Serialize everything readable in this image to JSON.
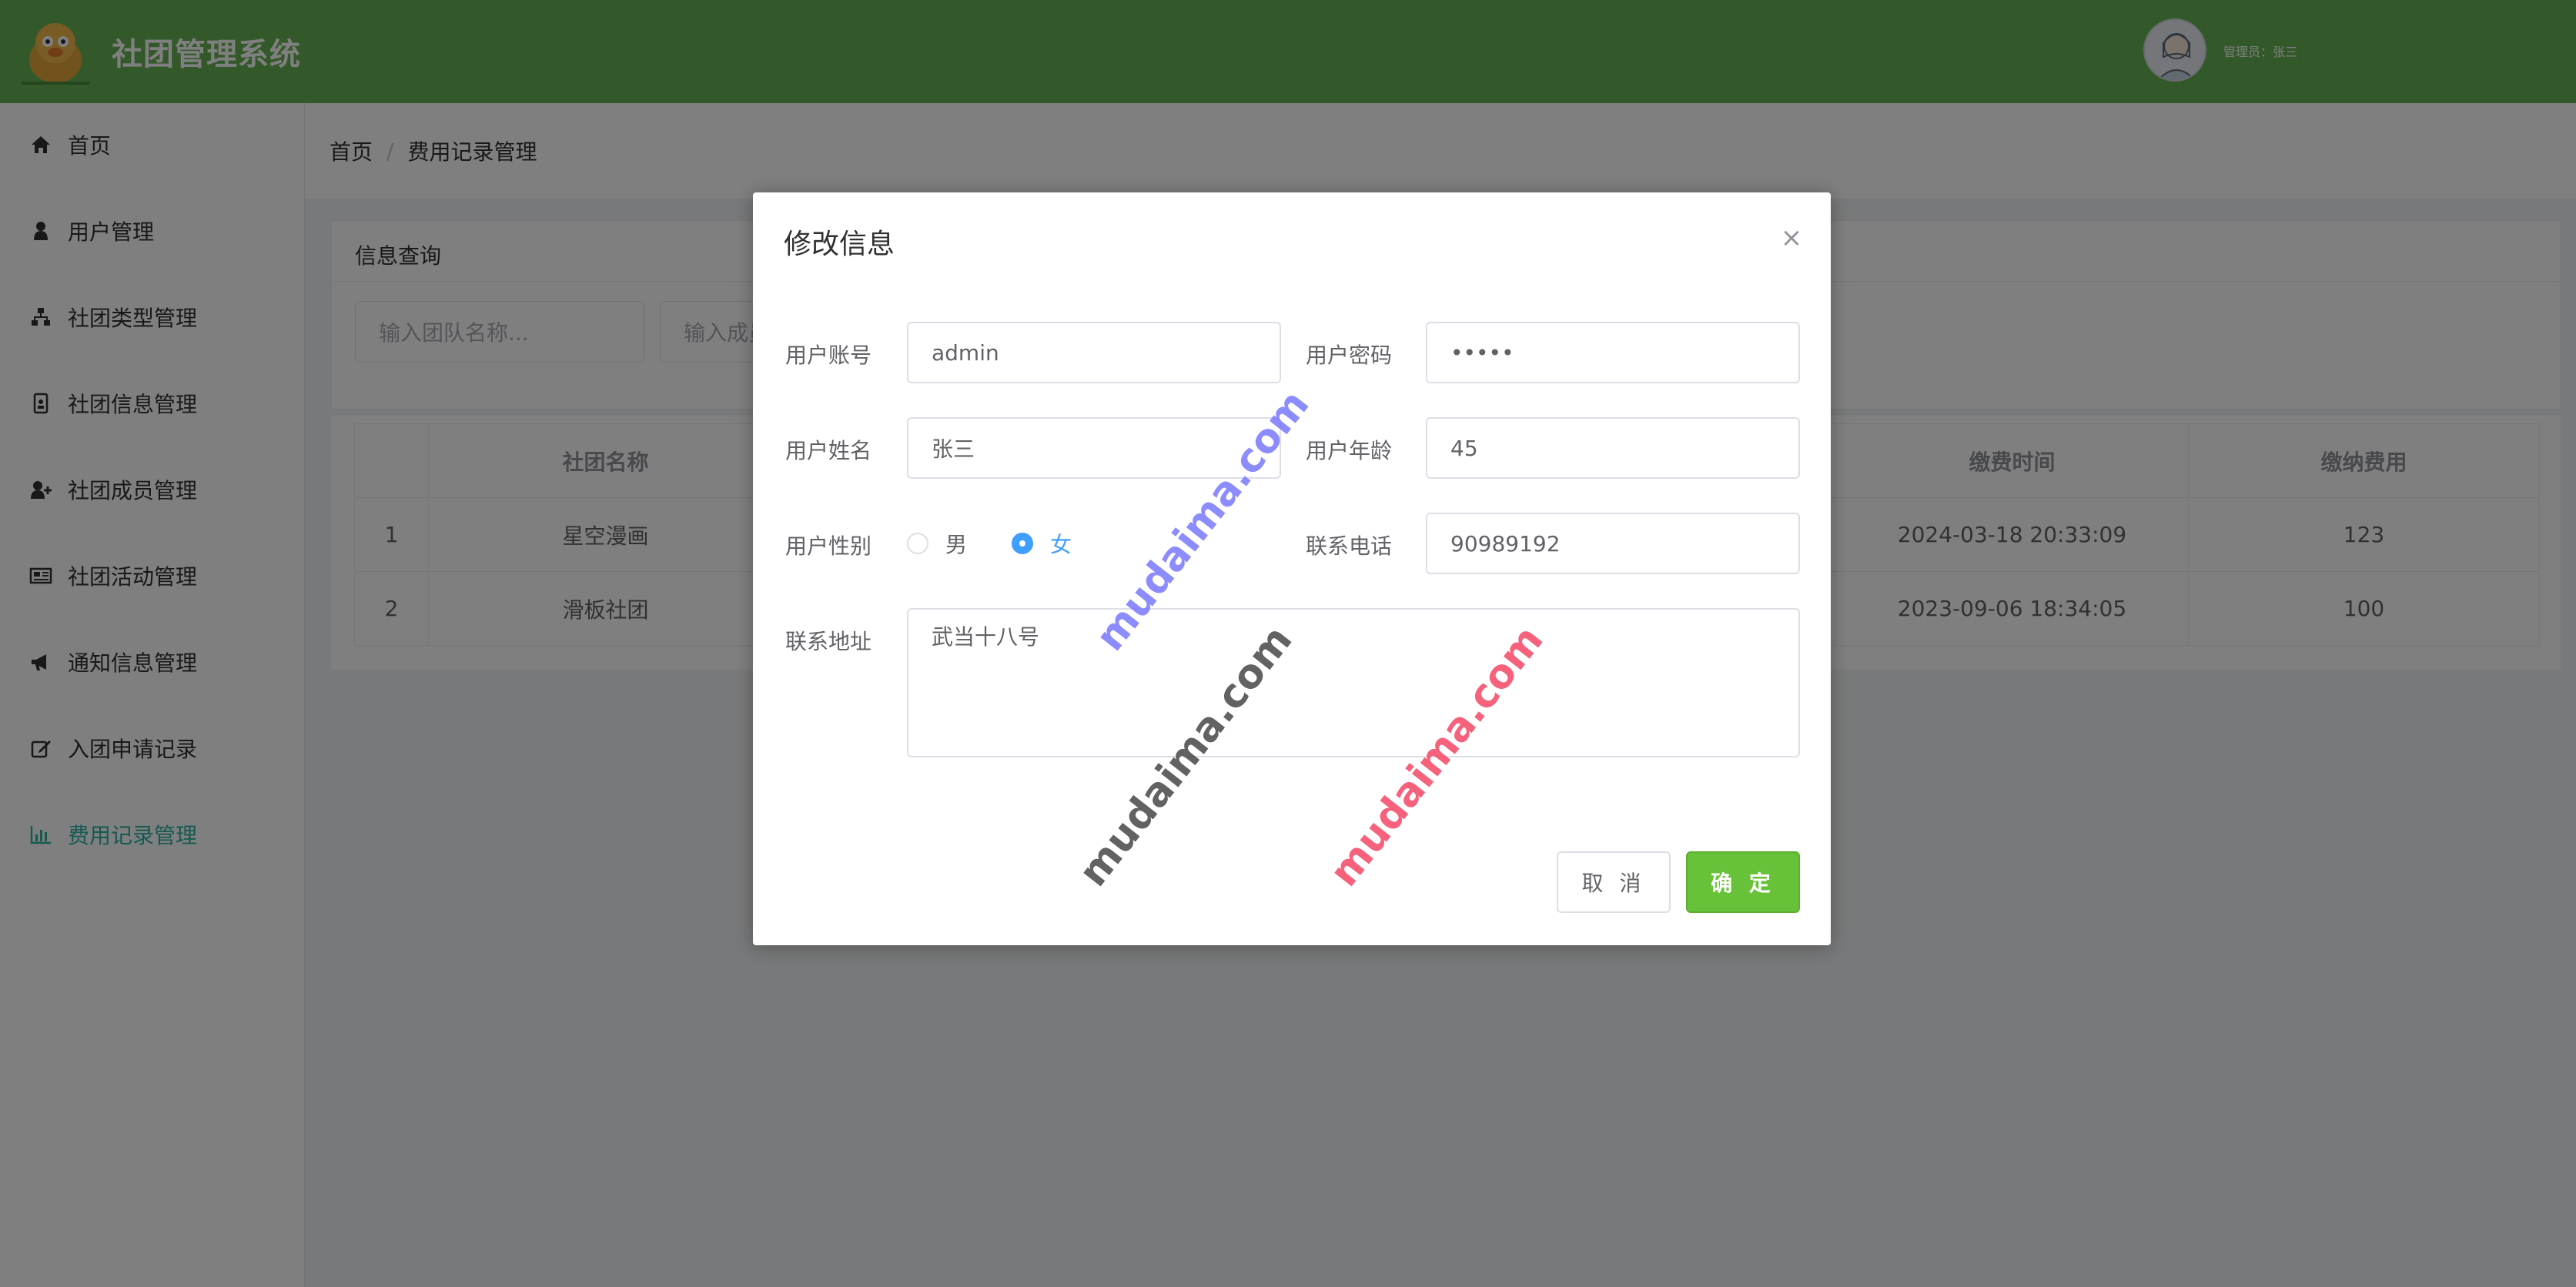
{
  "header": {
    "app_title": "社团管理系统",
    "admin_label": "管理员：张三"
  },
  "sidebar": {
    "items": [
      {
        "label": "首页",
        "icon": "home-icon"
      },
      {
        "label": "用户管理",
        "icon": "user-icon"
      },
      {
        "label": "社团类型管理",
        "icon": "sitemap-icon"
      },
      {
        "label": "社团信息管理",
        "icon": "id-card-icon"
      },
      {
        "label": "社团成员管理",
        "icon": "user-plus-icon"
      },
      {
        "label": "社团活动管理",
        "icon": "newspaper-icon"
      },
      {
        "label": "通知信息管理",
        "icon": "bullhorn-icon"
      },
      {
        "label": "入团申请记录",
        "icon": "edit-icon"
      },
      {
        "label": "费用记录管理",
        "icon": "bar-chart-icon",
        "active": true
      }
    ]
  },
  "breadcrumb": {
    "home": "首页",
    "sep": "/",
    "current": "费用记录管理"
  },
  "query": {
    "title": "信息查询",
    "team_placeholder": "输入团队名称...",
    "member_placeholder": "输入成员..."
  },
  "table": {
    "headers": [
      "",
      "社团名称",
      "缴费时间",
      "缴纳费用"
    ],
    "rows": [
      {
        "index": "1",
        "club": "星空漫画",
        "time": "2024-03-18 20:33:09",
        "fee": "123"
      },
      {
        "index": "2",
        "club": "滑板社团",
        "time": "2023-09-06 18:34:05",
        "fee": "100"
      }
    ]
  },
  "dialog": {
    "title": "修改信息",
    "close": "×",
    "fields": {
      "account_label": "用户账号",
      "account_value": "admin",
      "password_label": "用户密码",
      "password_value": "•••••",
      "name_label": "用户姓名",
      "name_value": "张三",
      "age_label": "用户年龄",
      "age_value": "45",
      "gender_label": "用户性别",
      "gender_male": "男",
      "gender_female": "女",
      "gender_selected": "女",
      "phone_label": "联系电话",
      "phone_value": "90989192",
      "address_label": "联系地址",
      "address_value": "武当十八号"
    },
    "cancel_label": "取 消",
    "ok_label": "确 定"
  },
  "watermarks": [
    "mudaima.com",
    "mudaima.com",
    "mudaima.com"
  ],
  "colors": {
    "header_bg": "#67b355",
    "active_menu": "#2bb3a3",
    "primary": "#409eff",
    "confirm": "#67c23a"
  }
}
